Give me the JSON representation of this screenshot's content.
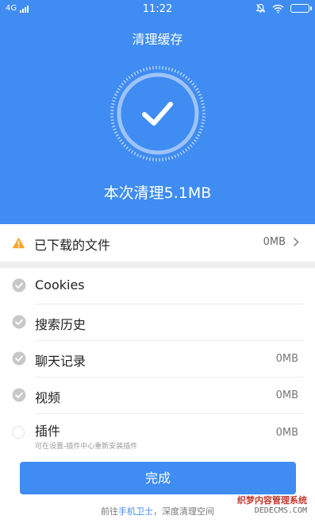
{
  "status_bar": {
    "network": "4G",
    "time": "11:22"
  },
  "header": {
    "title": "清理缓存",
    "result": "本次清理5.1MB"
  },
  "downloaded": {
    "label": "已下载的文件",
    "value": "0MB"
  },
  "items": [
    {
      "label": "Cookies",
      "value": "",
      "checked": true
    },
    {
      "label": "搜索历史",
      "value": "",
      "checked": true
    },
    {
      "label": "聊天记录",
      "value": "0MB",
      "checked": true
    },
    {
      "label": "视频",
      "value": "0MB",
      "checked": true
    },
    {
      "label": "插件",
      "value": "0MB",
      "checked": false,
      "sub": "可在设置-插件中心重新安装插件"
    }
  ],
  "done_button": "完成",
  "footer": {
    "prefix": "前往",
    "link": "手机卫士",
    "suffix": "，深度清理空间"
  },
  "watermark": {
    "cn": "织梦内容管理系统",
    "en": "DEDECMS.COM"
  },
  "colors": {
    "primary": "#3f8cf2",
    "warning": "#f5a623"
  }
}
